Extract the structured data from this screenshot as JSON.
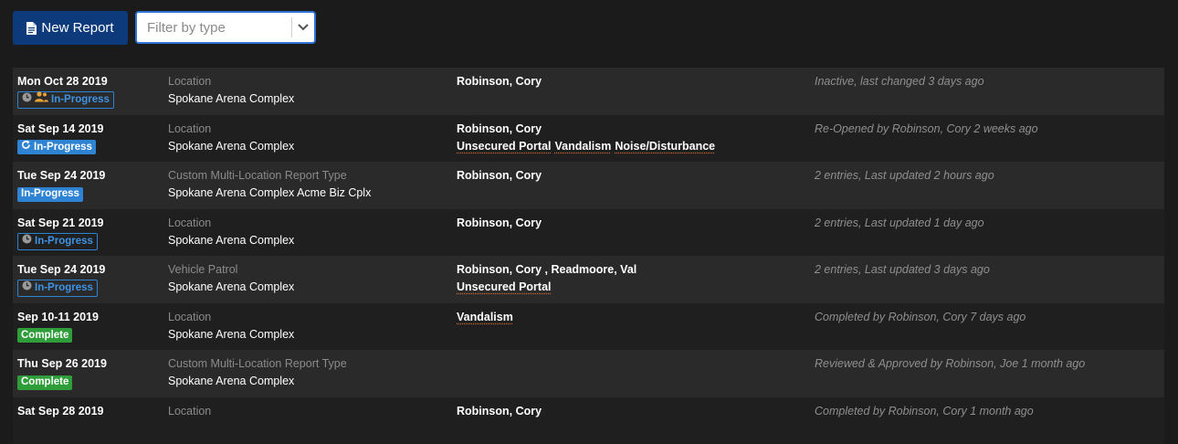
{
  "toolbar": {
    "new_report_label": "New Report",
    "new_report_icon": "document-icon",
    "filter_placeholder": "Filter by type",
    "filter_value": ""
  },
  "colors": {
    "primary_button": "#0d3a7a",
    "badge_blue": "#2f83d3",
    "badge_green": "#2f9e3a",
    "tag_underline": "#d16b2f"
  },
  "rows": [
    {
      "date": "Mon Oct 28 2019",
      "badge": {
        "label": "In-Progress",
        "style": "outline-blue",
        "icons": [
          "clock-icon",
          "assign-user-icon"
        ]
      },
      "type": "Location",
      "location": "Spokane Arena Complex",
      "people": "Robinson, Cory",
      "tags": [],
      "status": "Inactive, last changed 3 days ago"
    },
    {
      "date": "Sat Sep 14 2019",
      "badge": {
        "label": "In-Progress",
        "style": "filled-blue",
        "icons": [
          "reopen-icon"
        ]
      },
      "type": "Location",
      "location": "Spokane Arena Complex",
      "people": "Robinson, Cory",
      "tags": [
        "Unsecured Portal",
        "Vandalism",
        "Noise/Disturbance"
      ],
      "status": "Re-Opened by Robinson, Cory 2 weeks ago"
    },
    {
      "date": "Tue Sep 24 2019",
      "badge": {
        "label": "In-Progress",
        "style": "filled-blue",
        "icons": []
      },
      "type": "Custom Multi-Location Report Type",
      "location": "Spokane Arena Complex Acme Biz Cplx",
      "people": "Robinson, Cory",
      "tags": [],
      "status": "2 entries, Last updated 2 hours ago"
    },
    {
      "date": "Sat Sep 21 2019",
      "badge": {
        "label": "In-Progress",
        "style": "outline-blue",
        "icons": [
          "clock-icon"
        ]
      },
      "type": "Location",
      "location": "Spokane Arena Complex",
      "people": "Robinson, Cory",
      "tags": [],
      "status": "2 entries, Last updated 1 day ago"
    },
    {
      "date": "Tue Sep 24 2019",
      "badge": {
        "label": "In-Progress",
        "style": "outline-blue",
        "icons": [
          "clock-icon"
        ]
      },
      "type": "Vehicle Patrol",
      "location": "Spokane Arena Complex",
      "people": "Robinson, Cory , Readmoore, Val",
      "tags": [
        "Unsecured Portal"
      ],
      "status": "2 entries, Last updated 3 days ago"
    },
    {
      "date": "Sep 10-11 2019",
      "badge": {
        "label": "Complete",
        "style": "filled-green",
        "icons": []
      },
      "type": "Location",
      "location": "Spokane Arena Complex",
      "people": "",
      "tags": [
        "Vandalism"
      ],
      "status": "Completed by Robinson, Cory 7 days ago"
    },
    {
      "date": "Thu Sep 26 2019",
      "badge": {
        "label": "Complete",
        "style": "filled-green",
        "icons": []
      },
      "type": "Custom Multi-Location Report Type",
      "location": "Spokane Arena Complex",
      "people": "",
      "tags": [],
      "status": "Reviewed & Approved by Robinson, Joe 1 month ago"
    },
    {
      "date": "Sat Sep 28 2019",
      "badge": {
        "label": "",
        "style": "none",
        "icons": []
      },
      "type": "Location",
      "location": "",
      "people": "Robinson, Cory",
      "tags": [],
      "status": "Completed by Robinson, Cory 1 month ago"
    }
  ]
}
